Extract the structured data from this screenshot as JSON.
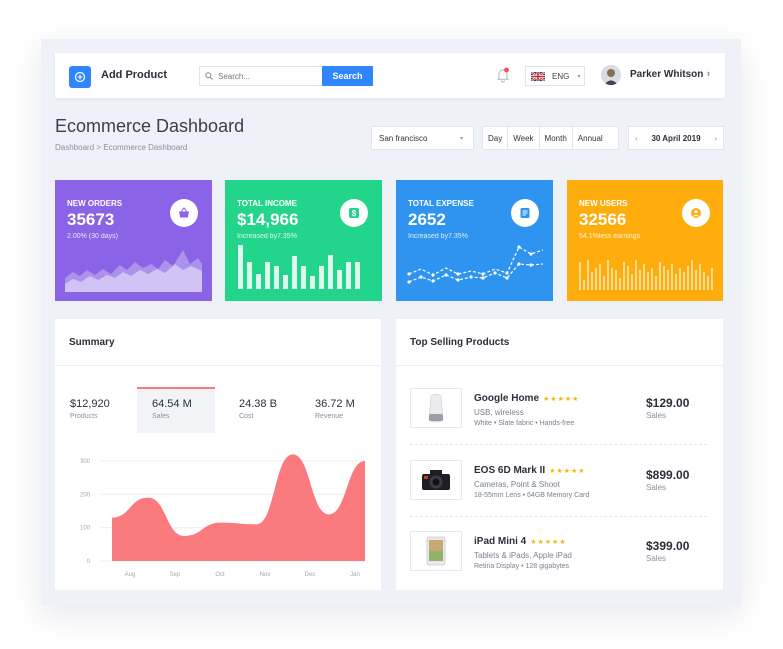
{
  "topbar": {
    "add_product_label": "Add Product",
    "search_placeholder": "Search...",
    "search_button": "Search",
    "language": "ENG",
    "user_name": "Parker Whitson"
  },
  "header": {
    "title": "Ecommerce Dashboard",
    "breadcrumb": "Dashboard > Ecommerce Dashboard",
    "city": "San francisco",
    "periods": [
      "Day",
      "Week",
      "Month",
      "Annual"
    ],
    "date": "30 April 2019"
  },
  "cards": [
    {
      "label": "NEW ORDERS",
      "value": "35673",
      "sub": "2.00% (30 days)",
      "color": "#8a63e6",
      "icon": "basket-icon"
    },
    {
      "label": "TOTAL INCOME",
      "value": "$14,966",
      "sub": "Increased by7.35%",
      "color": "#23d48b",
      "icon": "dollar-icon"
    },
    {
      "label": "TOTAL EXPENSE",
      "value": "2652",
      "sub": "Increased by7.35%",
      "color": "#2e94f0",
      "icon": "document-icon"
    },
    {
      "label": "NEW USERS",
      "value": "32566",
      "sub": "54.1%less earnings",
      "color": "#ffad0d",
      "icon": "user-icon"
    }
  ],
  "summary": {
    "title": "Summary",
    "stats": [
      {
        "value": "$12,920",
        "label": "Products"
      },
      {
        "value": "64.54 M",
        "label": "Sales"
      },
      {
        "value": "24.38 B",
        "label": "Cost"
      },
      {
        "value": "36.72 M",
        "label": "Revenue"
      }
    ]
  },
  "chart_data": {
    "type": "area",
    "x": [
      "Aug",
      "Sep",
      "Oct",
      "Nov",
      "Dec",
      "Jan"
    ],
    "yticks": [
      0,
      100,
      200,
      300
    ],
    "ylim": [
      0,
      300
    ],
    "color": "#fb7a7e",
    "values": [
      130,
      190,
      75,
      115,
      110,
      320,
      140,
      300
    ]
  },
  "top_selling": {
    "title": "Top Selling Products",
    "products": [
      {
        "name": "Google Home",
        "stars": "★★★★★",
        "category": "USB, wireless",
        "desc": "White • Slate fabric • Hands-free",
        "price": "$129.00",
        "price_label": "Sales",
        "icon": "speaker-icon"
      },
      {
        "name": "EOS 6D Mark II",
        "stars": "★★★★★",
        "category": "Cameras, Point & Shoot",
        "desc": "18-55mm Lens • 64GB Memory Card",
        "price": "$899.00",
        "price_label": "Sales",
        "icon": "camera-icon"
      },
      {
        "name": "iPad Mini 4",
        "stars": "★★★★★",
        "category": "Tablets & iPads, Apple iPad",
        "desc": "Retina Display • 128 gigabytes",
        "price": "$399.00",
        "price_label": "Sales",
        "icon": "tablet-icon"
      }
    ]
  }
}
